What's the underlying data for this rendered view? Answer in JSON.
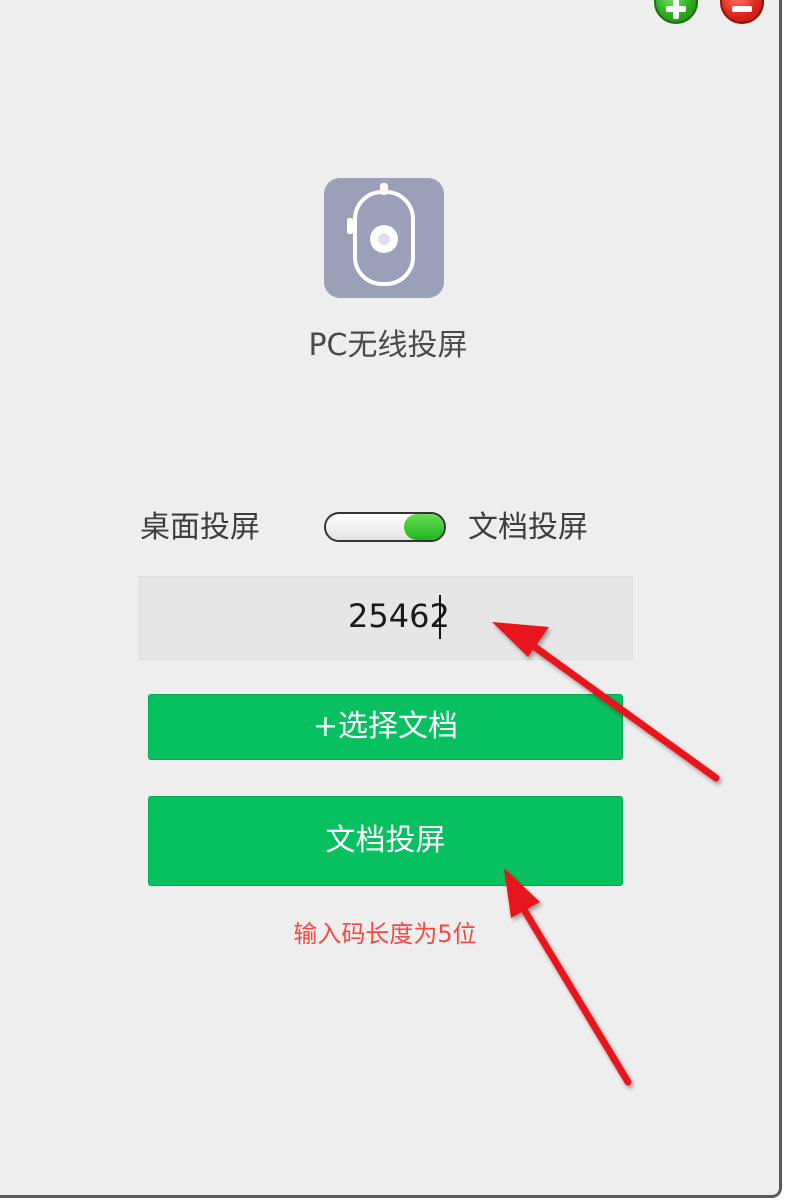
{
  "window": {
    "controls": {
      "add_icon": "plus-circle-icon",
      "remove_icon": "minus-circle-icon",
      "add_color": "#2faa1f",
      "remove_color": "#e0261a"
    }
  },
  "app": {
    "icon": "phone-cast-icon",
    "icon_color": "#9aa0b8",
    "title": "PC无线投屏"
  },
  "mode_switch": {
    "left_label": "桌面投屏",
    "right_label": "文档投屏",
    "selected": "文档投屏"
  },
  "code_input": {
    "value": "25462"
  },
  "buttons": {
    "select_document": "+选择文档",
    "document_cast": "文档投屏",
    "color": "#07c160"
  },
  "hint": {
    "text": "输入码长度为5位",
    "color": "#f24b43"
  },
  "annotations": {
    "arrow_color": "#e8141b"
  }
}
